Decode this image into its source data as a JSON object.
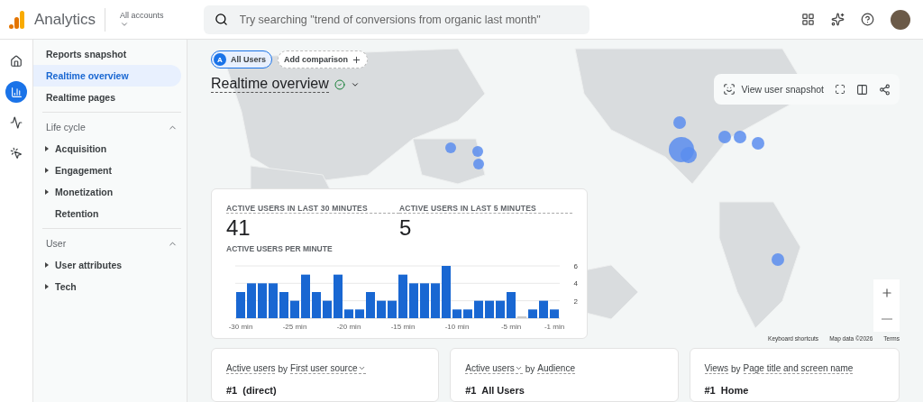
{
  "header": {
    "product": "Analytics",
    "account_label": "All accounts",
    "search": {
      "placeholder": "Try searching \"trend of conversions from organic last month\""
    }
  },
  "rail": [
    {
      "kind": "home",
      "selected": false
    },
    {
      "kind": "reports",
      "selected": true
    },
    {
      "kind": "explore",
      "selected": false
    },
    {
      "kind": "advertising",
      "selected": false
    }
  ],
  "nav": {
    "top_items": [
      {
        "label": "Reports snapshot",
        "selected": false
      },
      {
        "label": "Realtime overview",
        "selected": true
      },
      {
        "label": "Realtime pages",
        "selected": false
      }
    ],
    "sections": [
      {
        "title": "Life cycle",
        "expanded": true,
        "items": [
          {
            "label": "Acquisition",
            "expandable": true
          },
          {
            "label": "Engagement",
            "expandable": true
          },
          {
            "label": "Monetization",
            "expandable": true
          },
          {
            "label": "Retention",
            "expandable": false
          }
        ]
      },
      {
        "title": "User",
        "expanded": true,
        "items": [
          {
            "label": "User attributes",
            "expandable": true
          },
          {
            "label": "Tech",
            "expandable": true
          }
        ]
      }
    ]
  },
  "comparison": {
    "badge": "A",
    "chip": "All Users",
    "add_button": "Add comparison"
  },
  "title": "Realtime overview",
  "toolbar": {
    "snapshot_button": "View user snapshot"
  },
  "realtime_card": {
    "metrics": [
      {
        "label": "ACTIVE USERS IN LAST 30 MINUTES",
        "value": "41"
      },
      {
        "label": "ACTIVE USERS IN LAST 5 MINUTES",
        "value": "5"
      }
    ],
    "chart_label": "ACTIVE USERS PER MINUTE",
    "chart_data": {
      "type": "bar",
      "x": [
        -30,
        -29,
        -28,
        -27,
        -26,
        -25,
        -24,
        -23,
        -22,
        -21,
        -20,
        -19,
        -18,
        -17,
        -16,
        -15,
        -14,
        -13,
        -12,
        -11,
        -10,
        -9,
        -8,
        -7,
        -6,
        -5,
        -4,
        -3,
        -2,
        -1
      ],
      "values": [
        3,
        4,
        4,
        4,
        3,
        2,
        5,
        3,
        2,
        5,
        1,
        1,
        3,
        2,
        2,
        5,
        4,
        4,
        4,
        6,
        1,
        1,
        2,
        2,
        2,
        3,
        0,
        1,
        2,
        1
      ],
      "xlim": [
        -30.5,
        -0.5
      ],
      "ylim": [
        0,
        6
      ],
      "yticks": [
        2,
        4,
        6
      ],
      "xticks": [
        {
          "value": -30,
          "label": "-30 min"
        },
        {
          "value": -25,
          "label": "-25 min"
        },
        {
          "value": -20,
          "label": "-20 min"
        },
        {
          "value": -15,
          "label": "-15 min"
        },
        {
          "value": -10,
          "label": "-10 min"
        },
        {
          "value": -5,
          "label": "-5 min"
        },
        {
          "value": -1,
          "label": "-1 min"
        }
      ]
    }
  },
  "map_footer": [
    "Keyboard shortcuts",
    "Map data ©2026",
    "Terms"
  ],
  "bottom_cards": [
    {
      "metric": "Active users",
      "metric_dropdown": false,
      "joiner": "by",
      "dimension": "First user source",
      "dimension_dropdown": true,
      "first_row": "#1  (direct)"
    },
    {
      "metric": "Active users",
      "metric_dropdown": true,
      "joiner": "by",
      "dimension": "Audience",
      "dimension_dropdown": false,
      "first_row": "#1  All Users"
    },
    {
      "metric": "Views",
      "metric_dropdown": false,
      "joiner": "by",
      "dimension": "Page title and screen name",
      "dimension_dropdown": false,
      "first_row": "#1  Home"
    }
  ]
}
